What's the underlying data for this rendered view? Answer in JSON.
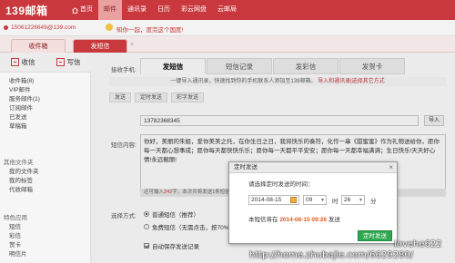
{
  "app": {
    "logo": "139邮箱"
  },
  "nav": {
    "items": [
      {
        "label": "首页",
        "icon": "home-icon"
      },
      {
        "label": "邮件"
      },
      {
        "label": "通讯录"
      },
      {
        "label": "日历"
      },
      {
        "label": "彩云网盘"
      },
      {
        "label": "云邮局"
      }
    ]
  },
  "user": {
    "email": "15061226649@139.com",
    "notice": "知你一起，度完这个国度!"
  },
  "tabs": {
    "inbox": "收件箱",
    "sms": "发短信",
    "close": "×"
  },
  "sidebar": {
    "compose": "收信",
    "write": "写信",
    "folders": [
      "收件箱(8)",
      "VIP邮件",
      "服务邮件(1)",
      "订阅邮件",
      "已发送",
      "草稿箱"
    ],
    "section_mine": "其他文件夹",
    "mine_items": [
      "我的文件夹",
      "我的标签",
      "代收邮箱"
    ],
    "section_special": "特色应用",
    "special_items": [
      "短信",
      "彩信",
      "贺卡",
      "明信片"
    ]
  },
  "main": {
    "tabs": [
      "发短信",
      "短信记录",
      "发彩信",
      "发贺卡"
    ],
    "tip": "一键导入通讯录，快速找到你的手机联系人添加至139邮箱。",
    "tip_link": "导入和通讯录|选择其它方式",
    "subtabs": [
      "发送",
      "定时发送",
      "彩字发送"
    ],
    "recipient_label": "接收手机:",
    "recipient_value": "13782368345",
    "import_label": "导入",
    "content_label": "短信内容:",
    "content_text": "你好，美丽的朱姐，爱你美美之托，在你生日之日，我将快乐的奏符，化作一串《甜蜜蜜》作为礼物送给你，愿你每一天都心想事成；愿你每天都快快乐乐；愿你每一天都平平安安；愿你每一天都幸福满满；生日快乐!天天好心情!永远靓丽!",
    "counter_prefix": "还可输入",
    "counter_num": "242",
    "counter_suffix": "字，本次共将发送1条短信",
    "options_label": "选择方式:",
    "option_normal": "普通短信（推荐）",
    "option_free": "免费短信（无需点击，按70%计费）",
    "save_option": "自动保存发送记录",
    "send_label": "发 送"
  },
  "dialog": {
    "title": "定时发送",
    "close": "×",
    "prompt": "请选择定时发送的时间：",
    "date": "2014-08-15",
    "hour": "09",
    "hour_unit": "时",
    "minute": "26",
    "minute_unit": "分",
    "note_prefix": "本短信将在",
    "note_time": "2014-08-15 09:26",
    "note_suffix": "发送",
    "send_button": "定时发送"
  },
  "watermark": {
    "name": "lovehe622",
    "url": "http://home.zhubajie.com/6629280/"
  }
}
